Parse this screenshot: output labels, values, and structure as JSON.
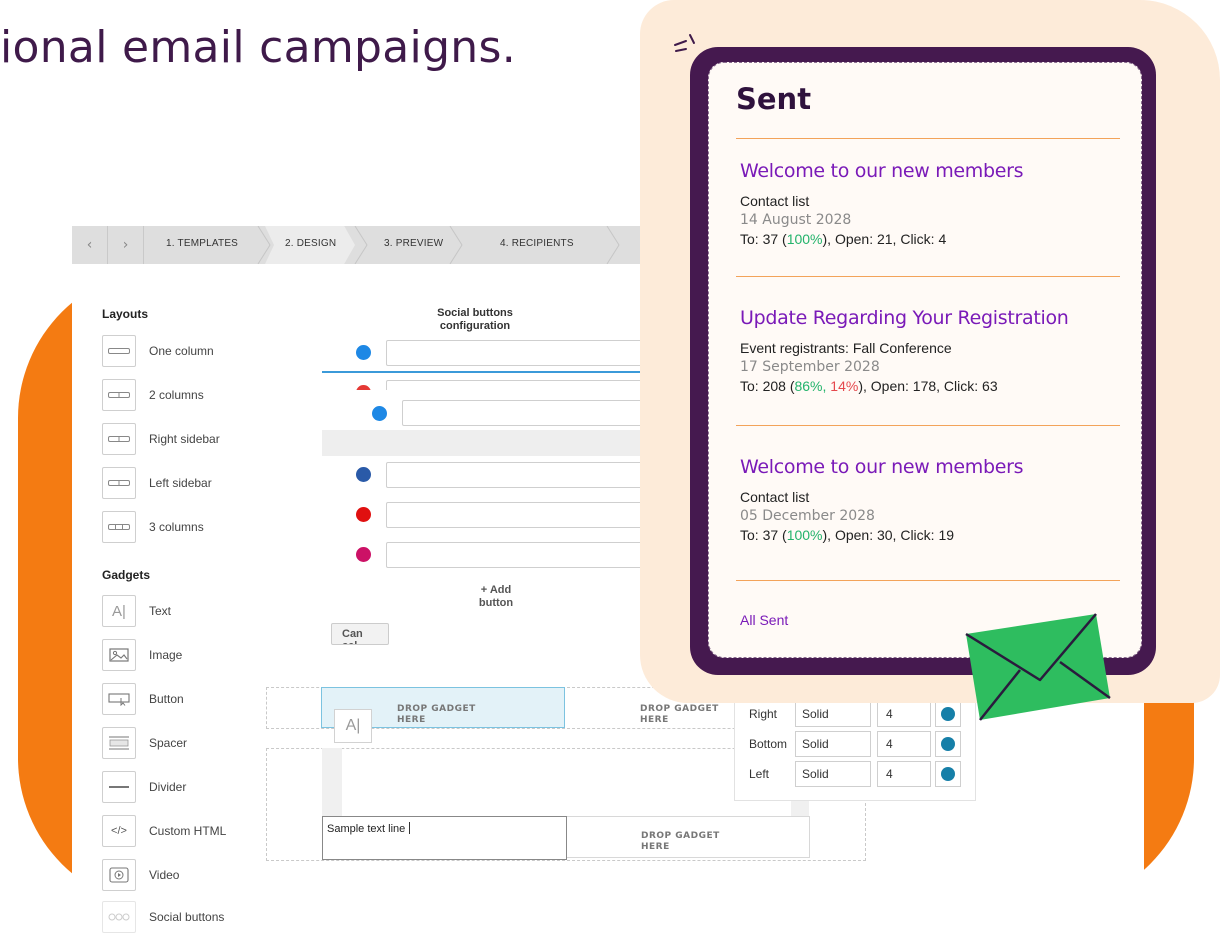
{
  "headline": "ional email campaigns.",
  "wizard": {
    "prev_icon": "‹",
    "next_icon": "›",
    "steps": [
      "1. TEMPLATES",
      "2. DESIGN",
      "3. PREVIEW",
      "4. RECIPIENTS"
    ],
    "active_step": "2. DESIGN"
  },
  "sidebar": {
    "layouts_heading": "Layouts",
    "layouts": [
      {
        "label": "One column",
        "icon": "one-column-icon"
      },
      {
        "label": "2 columns",
        "icon": "two-columns-icon"
      },
      {
        "label": "Right sidebar",
        "icon": "right-sidebar-icon"
      },
      {
        "label": "Left sidebar",
        "icon": "left-sidebar-icon"
      },
      {
        "label": "3 columns",
        "icon": "three-columns-icon"
      }
    ],
    "gadgets_heading": "Gadgets",
    "gadgets": [
      {
        "label": "Text",
        "icon": "text-icon",
        "glyph": "A|"
      },
      {
        "label": "Image",
        "icon": "image-icon"
      },
      {
        "label": "Button",
        "icon": "button-icon"
      },
      {
        "label": "Spacer",
        "icon": "spacer-icon"
      },
      {
        "label": "Divider",
        "icon": "divider-icon"
      },
      {
        "label": "Custom HTML",
        "icon": "code-icon",
        "glyph": "</>"
      },
      {
        "label": "Video",
        "icon": "video-icon"
      },
      {
        "label": "Social buttons",
        "icon": "social-buttons-icon"
      }
    ]
  },
  "social_config": {
    "title": "Social buttons configuration",
    "button_colors": [
      "#1e88e5",
      "#e53935",
      "#1e88e5",
      "#2a5aa8",
      "#e01010",
      "#cc1166"
    ],
    "add_button": "+ Add button",
    "cancel": "Can cel"
  },
  "canvas": {
    "drop_label": "DROP GADGET HERE",
    "drag_ghost_glyph": "A|",
    "sample_text": "Sample text line"
  },
  "border_settings": {
    "rows": [
      {
        "side": "Right",
        "style": "Solid",
        "width": "4",
        "color": "#167fa8"
      },
      {
        "side": "Bottom",
        "style": "Solid",
        "width": "4",
        "color": "#167fa8"
      },
      {
        "side": "Left",
        "style": "Solid",
        "width": "4",
        "color": "#167fa8"
      }
    ]
  },
  "sent_panel": {
    "title": "Sent",
    "campaigns": [
      {
        "name": "Welcome to our new members",
        "list": "Contact list",
        "date": "14 August 2028",
        "to_prefix": "To: 37 (",
        "pct_green": "100%",
        "pct_red": "",
        "to_suffix": "), Open: 21,  Click: 4"
      },
      {
        "name": "Update Regarding Your Registration",
        "list": "Event registrants: Fall Conference",
        "date": "17 September 2028",
        "to_prefix": "To: 208 (",
        "pct_green": "86%,",
        "pct_red": " 14%",
        "to_suffix": "), Open: 178,  Click: 63"
      },
      {
        "name": "Welcome to our new members",
        "list": "Contact list",
        "date": "05 December 2028",
        "to_prefix": "To: 37 (",
        "pct_green": "100%",
        "pct_red": "",
        "to_suffix": "), Open: 30,  Click: 19"
      }
    ],
    "all_sent_link": "All Sent"
  },
  "colors": {
    "headline": "#3f1a4a",
    "accent_orange": "#f47b12",
    "phone_frame": "#45194f",
    "campaign_title": "#7a1ab8",
    "stat_green": "#23b36b",
    "stat_red": "#e5484d",
    "envelope": "#2ebd5f"
  }
}
